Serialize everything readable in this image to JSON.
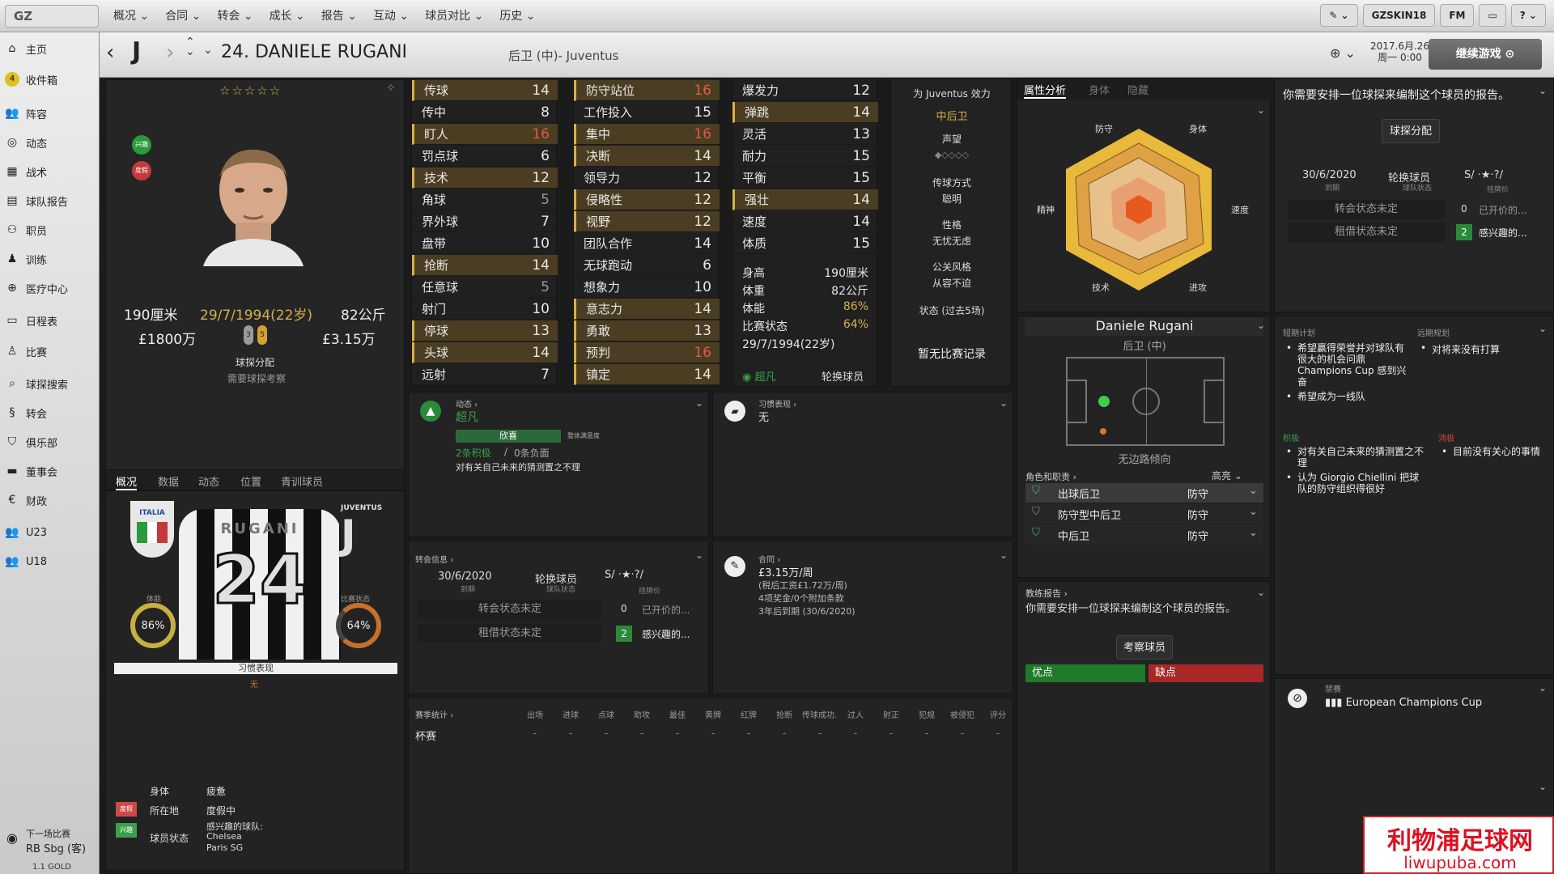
{
  "topbar": {
    "logo": "GZ",
    "menu": [
      "概况 ⌄",
      "合同 ⌄",
      "转会 ⌄",
      "成长 ⌄",
      "报告 ⌄",
      "互动 ⌄",
      "球员对比 ⌄",
      "历史 ⌄"
    ],
    "user": "GZSKIN18",
    "fm": "FM",
    "help": "? ⌄"
  },
  "sidebar": {
    "items": [
      "主页",
      "收件箱",
      "阵容",
      "动态",
      "战术",
      "球队报告",
      "职员",
      "训练",
      "医疗中心",
      "日程表",
      "比赛",
      "球探搜索",
      "转会",
      "俱乐部",
      "董事会",
      "财政",
      "U23",
      "U18"
    ],
    "inbox_badge": "4",
    "next_match_label": "下一场比赛",
    "next_match": "RB Sbg (客)",
    "version": "1.1 GOLD"
  },
  "header": {
    "name": "24. DANIELE RUGANI",
    "subtitle": "后卫 (中)- Juventus",
    "date": "2017.6月.26",
    "weekday": "周一 0:00",
    "continue": "继续游戏"
  },
  "profile": {
    "height": "190厘米",
    "dob": "29/7/1994(22岁)",
    "weight": "82公斤",
    "value": "£1800万",
    "wage": "£3.15万",
    "interest_tag": "兴趣",
    "holiday_tag": "度假",
    "scout_label": "球探分配",
    "scout_sub": "需要球探考察",
    "tabs": [
      "概况",
      "数据",
      "动态",
      "位置",
      "青训球员"
    ],
    "fitness_label": "体能",
    "fitness": "86%",
    "form_label": "比赛状态",
    "form": "64%",
    "habit_label": "习惯表现",
    "habit_value": "无",
    "shirt_number": "24",
    "shirt_name": "RUGANI",
    "italia": "ITALIA",
    "juventus": "JUVENTUS",
    "body_label": "身体",
    "body_value": "疲惫",
    "loc_label": "所在地",
    "loc_value": "度假中",
    "status_label": "球员状态",
    "status_value": "感兴趣的球队:",
    "club1": "Chelsea",
    "club2": "Paris SG",
    "holiday_badge": "度假",
    "interest_badge": "兴趣"
  },
  "tech": [
    [
      "传球",
      "14",
      "hl",
      ""
    ],
    [
      "传中",
      "8",
      "",
      ""
    ],
    [
      "盯人",
      "16",
      "hl",
      "red"
    ],
    [
      "罚点球",
      "6",
      "",
      ""
    ],
    [
      "技术",
      "12",
      "hl",
      ""
    ],
    [
      "角球",
      "5",
      "",
      "dim"
    ],
    [
      "界外球",
      "7",
      "",
      ""
    ],
    [
      "盘带",
      "10",
      "",
      ""
    ],
    [
      "抢断",
      "14",
      "hl",
      ""
    ],
    [
      "任意球",
      "5",
      "",
      "dim"
    ],
    [
      "射门",
      "10",
      "",
      ""
    ],
    [
      "停球",
      "13",
      "hl",
      ""
    ],
    [
      "头球",
      "14",
      "hl",
      ""
    ],
    [
      "远射",
      "7",
      "",
      ""
    ]
  ],
  "mental": [
    [
      "防守站位",
      "16",
      "hl",
      "red"
    ],
    [
      "工作投入",
      "15",
      "",
      ""
    ],
    [
      "集中",
      "16",
      "hl",
      "red"
    ],
    [
      "决断",
      "14",
      "hl",
      ""
    ],
    [
      "领导力",
      "12",
      "",
      ""
    ],
    [
      "侵略性",
      "12",
      "hl",
      ""
    ],
    [
      "视野",
      "12",
      "hl",
      ""
    ],
    [
      "团队合作",
      "14",
      "",
      ""
    ],
    [
      "无球跑动",
      "6",
      "",
      ""
    ],
    [
      "想象力",
      "10",
      "",
      ""
    ],
    [
      "意志力",
      "14",
      "hl",
      ""
    ],
    [
      "勇敢",
      "13",
      "hl",
      ""
    ],
    [
      "预判",
      "16",
      "hl",
      "red"
    ],
    [
      "镇定",
      "14",
      "hl",
      ""
    ]
  ],
  "physical": [
    [
      "爆发力",
      "12",
      "",
      ""
    ],
    [
      "弹跳",
      "14",
      "hl",
      ""
    ],
    [
      "灵活",
      "13",
      "",
      ""
    ],
    [
      "耐力",
      "15",
      "",
      ""
    ],
    [
      "平衡",
      "15",
      "",
      ""
    ],
    [
      "强壮",
      "14",
      "hl",
      ""
    ],
    [
      "速度",
      "14",
      "",
      ""
    ],
    [
      "体质",
      "15",
      "",
      ""
    ]
  ],
  "physinfo": [
    [
      "身高",
      "190厘米"
    ],
    [
      "体重",
      "82公斤"
    ],
    [
      "体能",
      "86%"
    ],
    [
      "比赛状态",
      "64%"
    ],
    [
      "29/7/1994(22岁)",
      ""
    ]
  ],
  "physinfo_extra": {
    "level": "超凡",
    "role": "轮换球员"
  },
  "effect": {
    "title": "为 Juventus 效力",
    "pos": "中后卫",
    "rep_label": "声望",
    "style_label": "传球方式",
    "style": "聪明",
    "pers_label": "性格",
    "pers": "无忧无虑",
    "media_label": "公关风格",
    "media": "从容不迫",
    "recent_label": "状态 (过去5场)",
    "recent": "暂无比赛记录"
  },
  "analysis": {
    "tabs": [
      "属性分析",
      "身体",
      "隐藏"
    ],
    "labels": {
      "def": "防守",
      "phy": "身体",
      "spd": "速度",
      "att": "进攻",
      "tec": "技术",
      "men": "精神"
    }
  },
  "scout_right": {
    "msg": "你需要安排一位球探来编制这个球员的报告。",
    "btn": "球探分配",
    "date": "30/6/2020",
    "date_sub": "到期",
    "role": "轮换球员",
    "role_sub": "球队状态",
    "price": "S/ ·★·?/",
    "price_sub": "挂牌价",
    "t1": "转会状态未定",
    "n1": "0",
    "t1b": "已开价的...",
    "t2": "租借状态未定",
    "n2": "2",
    "t2b": "感兴趣的..."
  },
  "plans": {
    "short": "短期计划",
    "long": "远期规划",
    "s1": "希望赢得荣誉并对球队有很大的机会问鼎 Champions Cup 感到兴奋",
    "s2": "希望成为一线队",
    "l1": "对将来没有打算",
    "pos": "积极",
    "neg": "消极",
    "p1": "对有关自己未来的猜测置之不理",
    "p2": "认为 Giorgio Chiellini 把球队的防守组织得很好",
    "n1": "目前没有关心的事情"
  },
  "banned": {
    "title": "禁赛",
    "comp": "European Champions Cup"
  },
  "player_card": {
    "name": "Daniele Rugani",
    "pos": "后卫 (中)",
    "side": "无边路倾向",
    "roles_label": "角色和职责 ›",
    "roles_level": "高亮",
    "roles": [
      [
        "出球后卫",
        "防守"
      ],
      [
        "防守型中后卫",
        "防守"
      ],
      [
        "中后卫",
        "防守"
      ]
    ]
  },
  "coach": {
    "title": "教练报告 ›",
    "msg": "你需要安排一位球探来编制这个球员的报告。",
    "btn": "考察球员",
    "pros": "优点",
    "cons": "缺点"
  },
  "dynamic": {
    "title": "动态 ›",
    "level": "超凡",
    "mood": "欣喜",
    "mood_sub": "整体满意度",
    "pos_count": "2条积极",
    "neg_count": "0条负面",
    "note": "对有关自己未来的猜测置之不理"
  },
  "habit": {
    "title": "习惯表现 ›",
    "value": "无"
  },
  "transfer": {
    "title": "转会信息 ›",
    "date": "30/6/2020",
    "date_sub": "到期",
    "role": "轮换球员",
    "role_sub": "球队状态",
    "price": "S/ ·★·?/",
    "price_sub": "挂牌价",
    "t1": "转会状态未定",
    "n1": "0",
    "t1b": "已开价的...",
    "t2": "租借状态未定",
    "n2": "2",
    "t2b": "感兴趣的..."
  },
  "contract": {
    "title": "合同 ›",
    "wage": "£3.15万/周",
    "net": "(税后工资£1.72万/周)",
    "bonus": "4项奖金/0个附加条款",
    "end": "3年后到期 (30/6/2020)"
  },
  "stats": {
    "title": "赛季统计 ›",
    "cols": [
      "出场",
      "进球",
      "点球",
      "助攻",
      "最佳",
      "黄牌",
      "红牌",
      "抢断",
      "传球成功...",
      "过人",
      "射正",
      "犯规",
      "被侵犯",
      "评分"
    ],
    "row_label": "杯赛",
    "dash": "-"
  },
  "watermark": {
    "cn": "利物浦足球网",
    "url": "liwupuba.com"
  }
}
